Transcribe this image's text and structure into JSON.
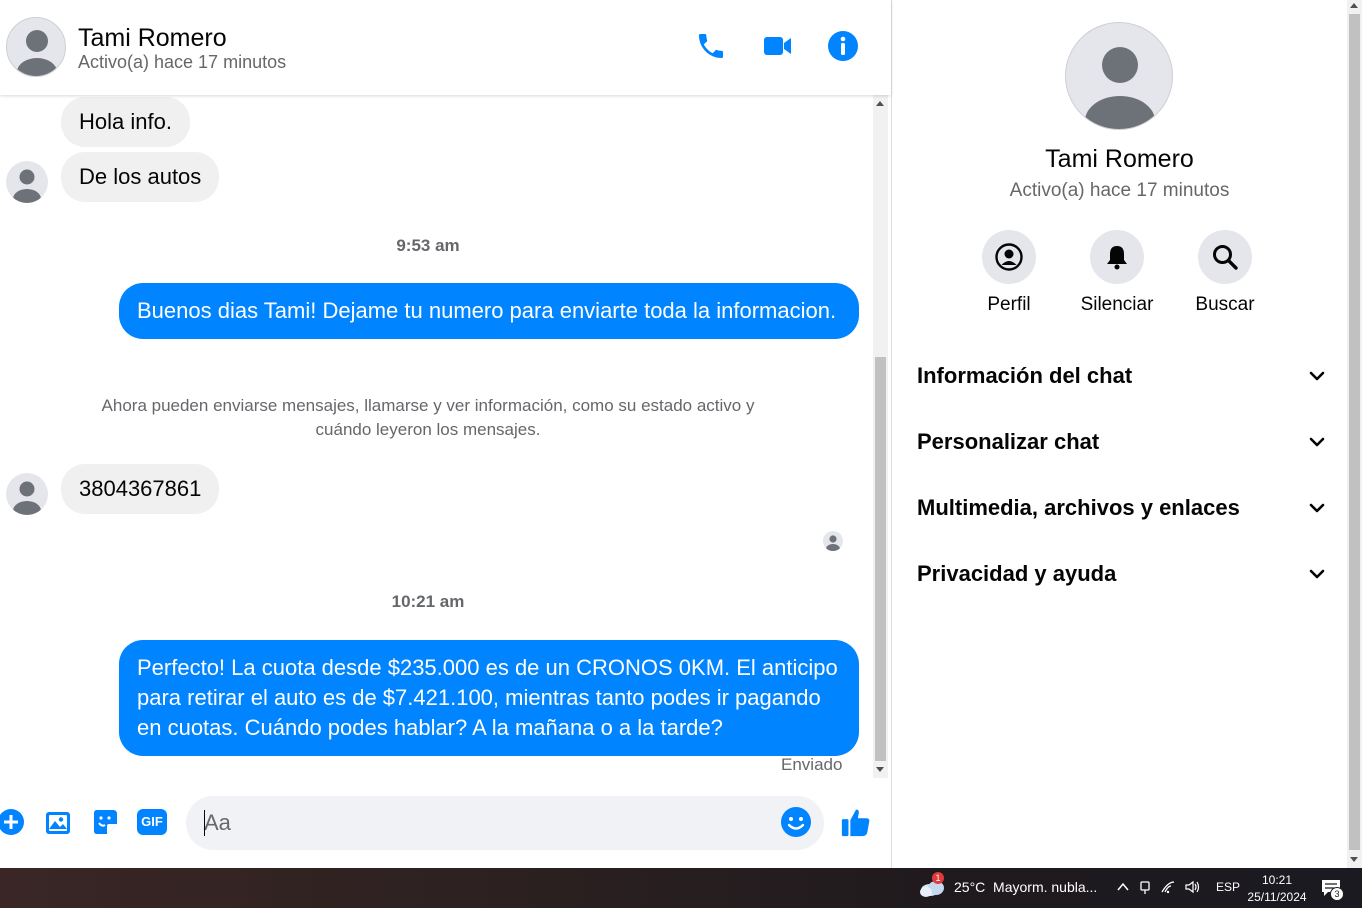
{
  "header": {
    "name": "Tami Romero",
    "status": "Activo(a) hace 17 minutos"
  },
  "messages": {
    "in1": "Hola info.",
    "in2": "De los autos",
    "time1": "9:53 am",
    "out1": "Buenos dias Tami! Dejame tu numero para enviarte toda la informacion.",
    "notice": "Ahora pueden enviarse mensajes, llamarse y ver información, como su estado activo y cuándo leyeron los mensajes.",
    "in3": "3804367861",
    "time2": "10:21 am",
    "out2": "Perfecto! La cuota desde $235.000 es de un CRONOS 0KM. El anticipo para retirar el auto es de $7.421.100, mientras tanto podes ir pagando en cuotas. Cuándo podes hablar? A la mañana o a la tarde?",
    "sent": "Enviado"
  },
  "composer": {
    "placeholder": "Aa",
    "gif_label": "GIF"
  },
  "info": {
    "name": "Tami Romero",
    "status": "Activo(a) hace 17 minutos",
    "actions": [
      {
        "label": "Perfil",
        "icon": "profile-icon"
      },
      {
        "label": "Silenciar",
        "icon": "bell-icon"
      },
      {
        "label": "Buscar",
        "icon": "search-icon"
      }
    ],
    "sections": [
      "Información del chat",
      "Personalizar chat",
      "Multimedia, archivos y enlaces",
      "Privacidad y ayuda"
    ]
  },
  "taskbar": {
    "weather_badge": "1",
    "weather": "25°C  Mayorm. nubla...",
    "language": "ESP",
    "time": "10:21",
    "date": "25/11/2024",
    "notif_count": "3"
  },
  "colors": {
    "accent": "#0084ff",
    "incoming_bubble": "#f0f0f0",
    "muted_text": "#65676b"
  }
}
